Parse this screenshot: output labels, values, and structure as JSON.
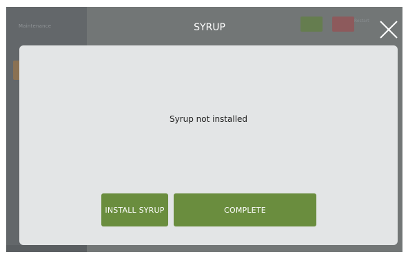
{
  "header": {
    "title": "SYRUP",
    "sidebar_label": "Maintenance",
    "status_label": "Restart"
  },
  "dialog": {
    "message": "Syrup not installed",
    "install_label": "INSTALL SYRUP",
    "complete_label": "COMPLETE"
  },
  "colors": {
    "backdrop": "#727676",
    "dialog": "#e3e5e6",
    "button": "#6a8d3e"
  },
  "icons": {
    "close": "close-icon"
  }
}
